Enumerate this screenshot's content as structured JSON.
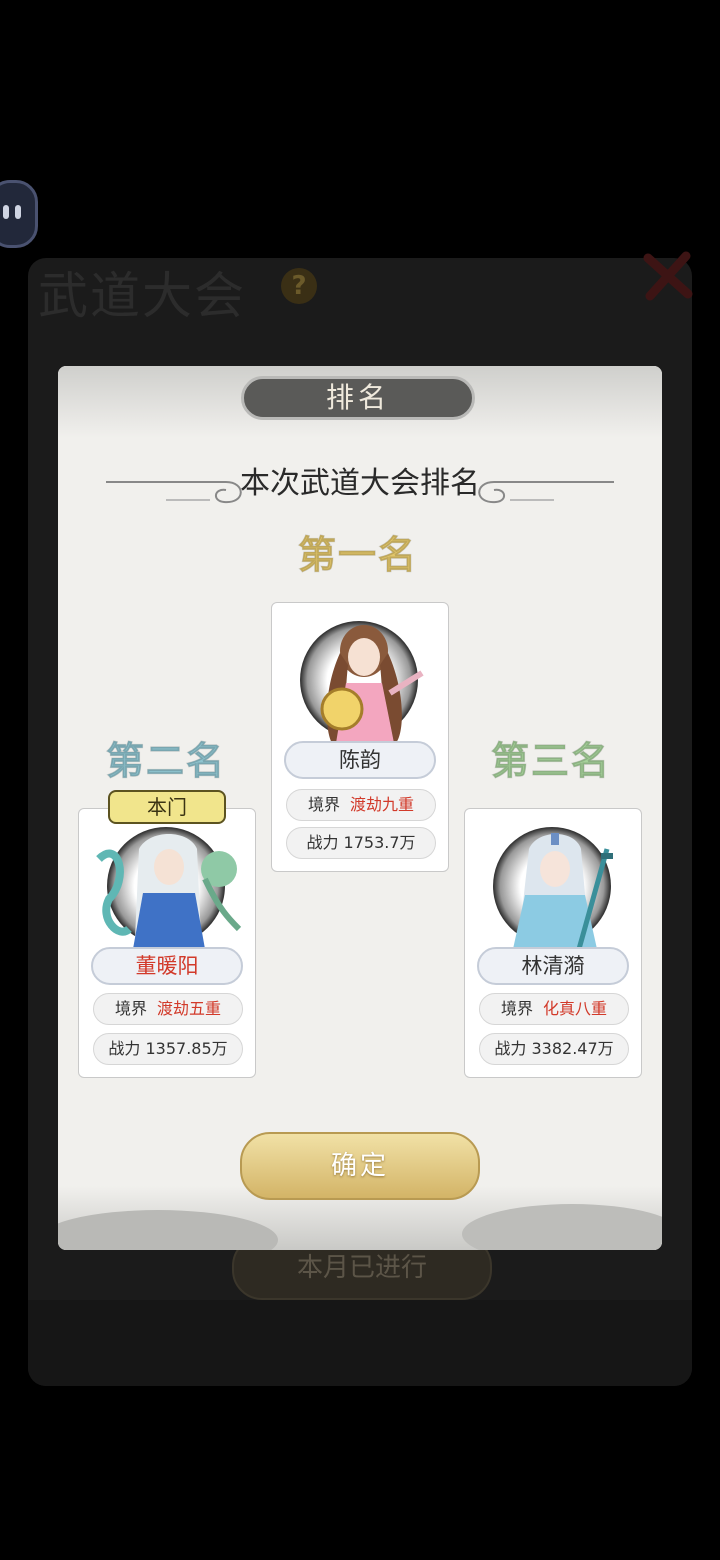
{
  "background": {
    "title": "武道大会",
    "help_icon": "?",
    "month_status": "本月已进行"
  },
  "modal": {
    "title": "排名",
    "subtitle": "本次武道大会排名",
    "confirm_label": "确定"
  },
  "ranks": {
    "first": {
      "label": "第一名",
      "name": "陈韵",
      "realm_label": "境界",
      "realm": "渡劫九重",
      "power_label": "战力",
      "power": "1753.7万"
    },
    "second": {
      "label": "第二名",
      "tag": "本门",
      "name": "董暖阳",
      "realm_label": "境界",
      "realm": "渡劫五重",
      "power_label": "战力",
      "power": "1357.85万"
    },
    "third": {
      "label": "第三名",
      "name": "林清漪",
      "realm_label": "境界",
      "realm": "化真八重",
      "power_label": "战力",
      "power": "3382.47万"
    }
  },
  "colors": {
    "first": "#e2c66a",
    "second": "#8fc4cf",
    "third": "#a6d29a",
    "realm_value": "#d23a2a"
  }
}
